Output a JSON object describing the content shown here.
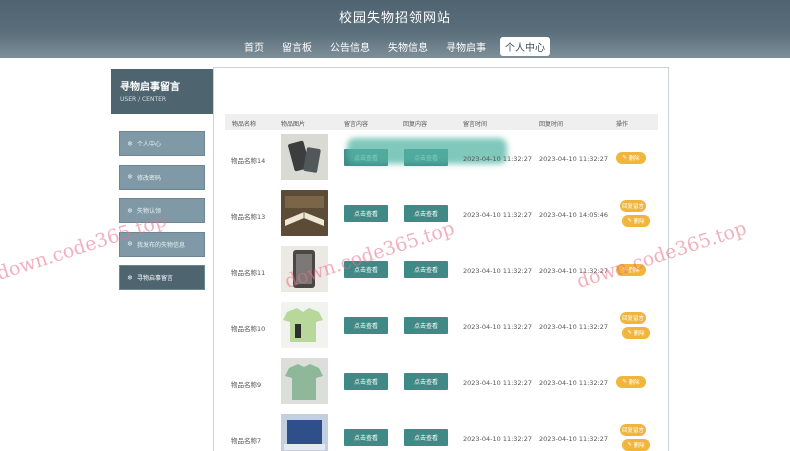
{
  "site": {
    "title": "校园失物招领网站"
  },
  "nav": [
    {
      "label": "首页"
    },
    {
      "label": "留言板"
    },
    {
      "label": "公告信息"
    },
    {
      "label": "失物信息"
    },
    {
      "label": "寻物启事"
    },
    {
      "label": "个人中心",
      "active": true
    }
  ],
  "sidebar": {
    "title": "寻物启事留言",
    "subtitle": "USER / CENTER",
    "items": [
      {
        "label": "个人中心"
      },
      {
        "label": "修改密码"
      },
      {
        "label": "失物认领"
      },
      {
        "label": "我发布的失物信息"
      },
      {
        "label": "寻物启事留言",
        "active": true
      }
    ]
  },
  "table": {
    "headers": [
      "物品名称",
      "物品图片",
      "留言内容",
      "回复内容",
      "留言时间",
      "回复时间",
      "操作"
    ],
    "view_label": "点击查看",
    "reply_label": "回复留言",
    "delete_label": "删除",
    "rows": [
      {
        "name": "物品名称14",
        "msg_time": "2023-04-10 11:32:27",
        "reply_time": "2023-04-10 11:32:27",
        "can_reply": false
      },
      {
        "name": "物品名称13",
        "msg_time": "2023-04-10 11:32:27",
        "reply_time": "2023-04-10 14:05:46",
        "can_reply": true
      },
      {
        "name": "物品名称11",
        "msg_time": "2023-04-10 11:32:27",
        "reply_time": "2023-04-10 11:32:27",
        "can_reply": false
      },
      {
        "name": "物品名称10",
        "msg_time": "2023-04-10 11:32:27",
        "reply_time": "2023-04-10 11:32:27",
        "can_reply": true
      },
      {
        "name": "物品名称9",
        "msg_time": "2023-04-10 11:32:27",
        "reply_time": "2023-04-10 11:32:27",
        "can_reply": false
      },
      {
        "name": "物品名称7",
        "msg_time": "2023-04-10 11:32:27",
        "reply_time": "2023-04-10 11:32:27",
        "can_reply": true
      }
    ]
  },
  "watermark": "down.code365.top",
  "colors": {
    "header": "#4f6470",
    "teal_button": "#3f8a86",
    "pill": "#f0b53a",
    "watermark": "#e7708a"
  }
}
